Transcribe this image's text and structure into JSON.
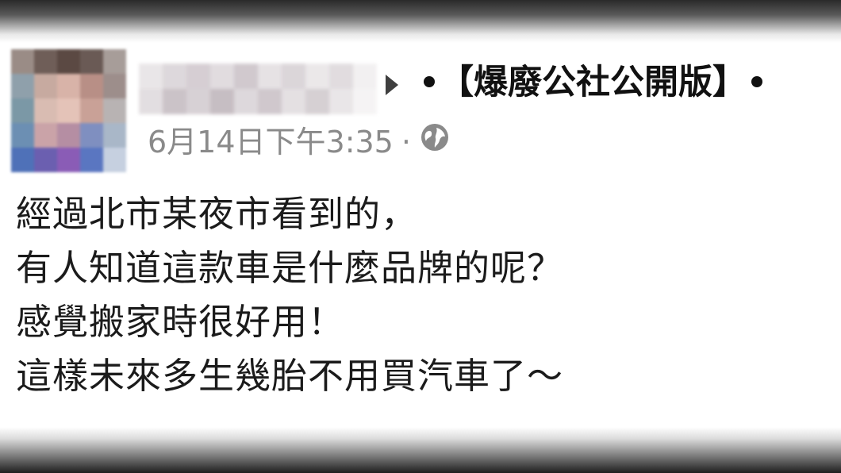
{
  "post": {
    "group_name": "【爆廢公社公開版】",
    "timestamp": "6月14日下午3:35",
    "separator": "·",
    "privacy_icon": "globe-icon",
    "lines": [
      "經過北市某夜市看到的，",
      "有人知道這款車是什麼品牌的呢？",
      "感覺搬家時很好用！",
      "這樣未來多生幾胎不用買汽車了～"
    ]
  },
  "colors": {
    "avatar_pixels": [
      "#9a8c86",
      "#6f5e58",
      "#5b4943",
      "#6a5a55",
      "#a79d99",
      "#8fa0ab",
      "#c7aaa0",
      "#d8b3a8",
      "#b88f86",
      "#9d8e8b",
      "#7b98a6",
      "#d9bcb2",
      "#e4c3b8",
      "#c9a197",
      "#b8b3b3",
      "#6c8fb3",
      "#caa3a8",
      "#b58ea3",
      "#7f8fc0",
      "#a9b7c8",
      "#4f71b8",
      "#6b5fb0",
      "#8a5cb6",
      "#5a76c1",
      "#c6d0e0"
    ],
    "name_pixels": [
      "#e6e2e4",
      "#d8d2d6",
      "#cfc6cc",
      "#dcd6da",
      "#c9c0c6",
      "#e2dde0",
      "#d5cfd3",
      "#e8e4e6",
      "#dcd7da",
      "#f0eeef",
      "#ded9dc",
      "#c3b9bf",
      "#d1c9ce",
      "#bdb3b9",
      "#d8d2d6",
      "#c8bfc5",
      "#e0dbde",
      "#cfc8cc",
      "#e6e2e4",
      "#f4f2f3"
    ]
  }
}
